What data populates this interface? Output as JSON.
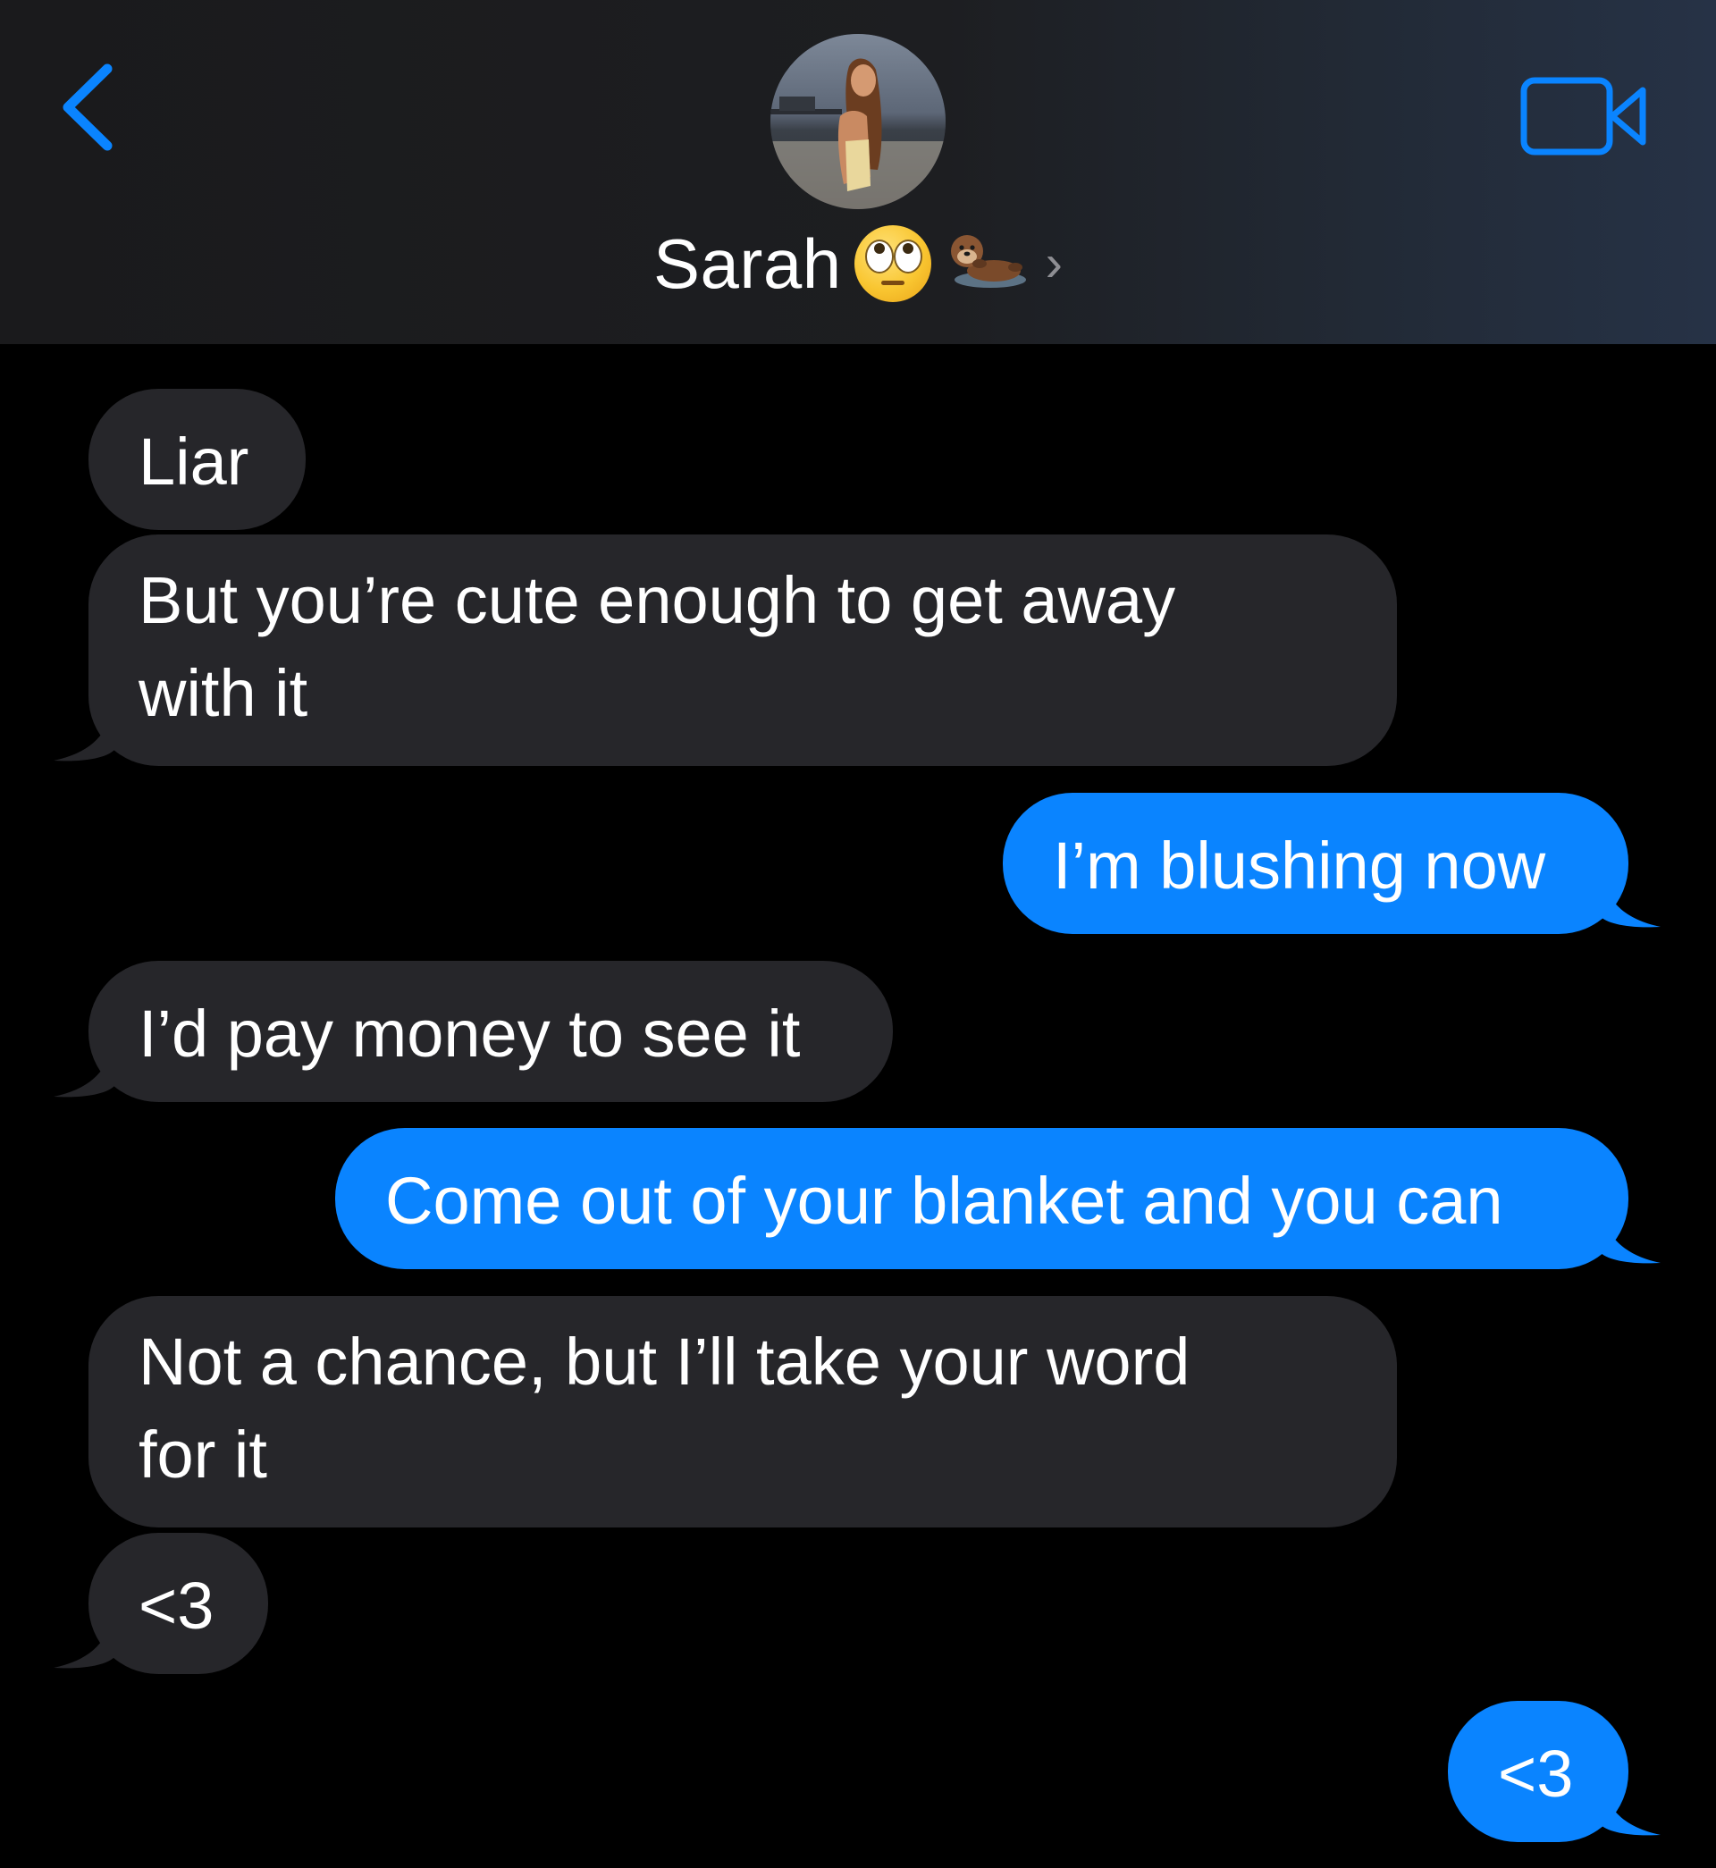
{
  "header": {
    "back_icon": "chevron-left-icon",
    "video_icon": "video-camera-icon",
    "contact_name": "Sarah",
    "contact_emoji_1": "eye-roll-emoji",
    "contact_emoji_2": "otter-emoji",
    "chevron": "›",
    "accent_color": "#0a84ff"
  },
  "messages": [
    {
      "id": "m1",
      "direction": "received",
      "text": "Liar"
    },
    {
      "id": "m2",
      "direction": "received",
      "line1": "But you’re cute enough to get away",
      "line2": "with it"
    },
    {
      "id": "m3",
      "direction": "sent",
      "text": "I’m blushing now"
    },
    {
      "id": "m4",
      "direction": "received",
      "text": "I’d pay money to see it"
    },
    {
      "id": "m5",
      "direction": "sent",
      "text": "Come out of your blanket and you can"
    },
    {
      "id": "m6",
      "direction": "received",
      "line1": "Not a chance, but I’ll take your word",
      "line2": "for it"
    },
    {
      "id": "m7",
      "direction": "received",
      "text": "<3"
    },
    {
      "id": "m8",
      "direction": "sent",
      "text": "<3"
    }
  ],
  "colors": {
    "received_bubble": "#26262a",
    "sent_bubble": "#0a84ff",
    "background": "#000000"
  }
}
